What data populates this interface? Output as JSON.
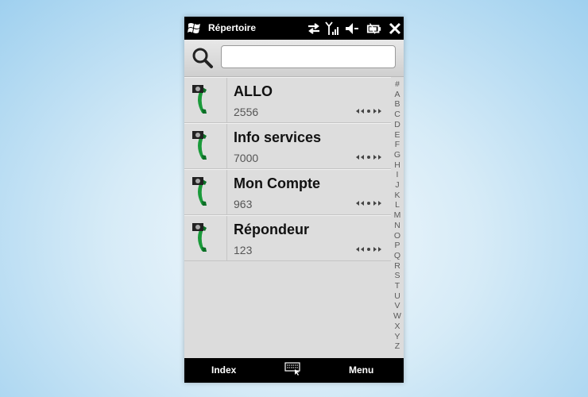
{
  "statusbar": {
    "title": "Répertoire",
    "icons": [
      "windows-logo",
      "data-connection-icon",
      "signal-icon",
      "volume-muted-icon",
      "battery-icon",
      "close-icon"
    ]
  },
  "search": {
    "value": "",
    "placeholder": ""
  },
  "contacts": [
    {
      "name": "ALLO",
      "number": "2556"
    },
    {
      "name": "Info services",
      "number": "7000"
    },
    {
      "name": "Mon Compte",
      "number": "963"
    },
    {
      "name": "Répondeur",
      "number": "123"
    }
  ],
  "alphabet": [
    "#",
    "A",
    "B",
    "C",
    "D",
    "E",
    "F",
    "G",
    "H",
    "I",
    "J",
    "K",
    "L",
    "M",
    "N",
    "O",
    "P",
    "Q",
    "R",
    "S",
    "T",
    "U",
    "V",
    "W",
    "X",
    "Y",
    "Z"
  ],
  "softkeys": {
    "left": "Index",
    "right": "Menu"
  },
  "colors": {
    "accent_green": "#1a9a3a",
    "bar": "#000000",
    "row_bg": "#dddddd"
  }
}
